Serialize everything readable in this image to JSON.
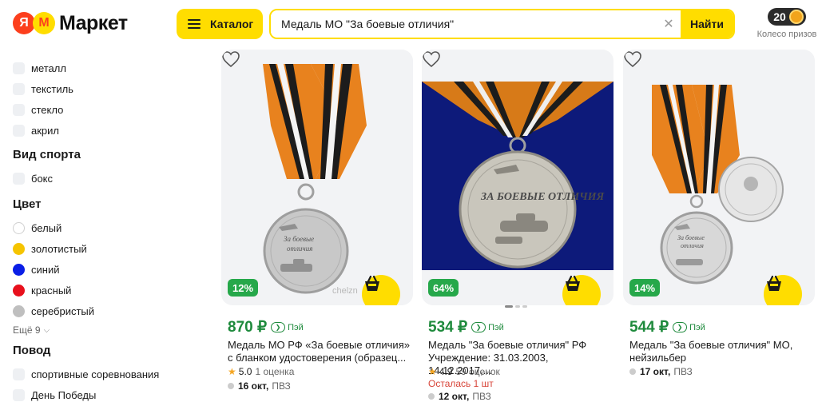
{
  "header": {
    "logo_text": "Маркет",
    "logo_ya": "Я",
    "logo_m": "M",
    "catalog_label": "Каталог",
    "search_value": "Медаль МО \"За боевые отличия\"",
    "search_button": "Найти",
    "prize_count": "20",
    "prize_label": "Колесо призов"
  },
  "sidebar": {
    "material_options": [
      "металл",
      "текстиль",
      "стекло",
      "акрил"
    ],
    "sport_title": "Вид спорта",
    "sport_options": [
      "бокс"
    ],
    "color_title": "Цвет",
    "color_options": [
      {
        "label": "белый",
        "color": "#ffffff"
      },
      {
        "label": "золотистый",
        "color": "#f5c400"
      },
      {
        "label": "синий",
        "color": "#0a1ee6"
      },
      {
        "label": "красный",
        "color": "#e8101c"
      },
      {
        "label": "серебристый",
        "color": "#bfbfbf"
      }
    ],
    "more_label": "Ещё 9",
    "occasion_title": "Повод",
    "occasion_options": [
      "спортивные соревнования",
      "День Победы"
    ]
  },
  "products": [
    {
      "discount": "12%",
      "price": "870 ₽",
      "pay_label": "Пэй",
      "title": "Медаль МО РФ «За боевые отличия» с бланком удостоверения (образец...",
      "rating": "5.0",
      "reviews": "1 оценка",
      "stock_note": "",
      "delivery_date": "16 окт,",
      "delivery_type": "ПВЗ",
      "watermark": "chelzn"
    },
    {
      "discount": "64%",
      "price": "534 ₽",
      "pay_label": "Пэй",
      "title": "Медаль \"За боевые отличия\" РФ Учреждение: 31.03.2003, 14.12.2017,...",
      "rating": "4.9",
      "reviews": "59 оценок",
      "stock_note": "Осталась 1 шт",
      "delivery_date": "12 окт,",
      "delivery_type": "ПВЗ",
      "medal_text": "ЗА БОЕВЫЕ ОТЛИЧИЯ"
    },
    {
      "discount": "14%",
      "price": "544 ₽",
      "pay_label": "Пэй",
      "title": "Медаль \"За боевые отличия\" МО, нейзильбер",
      "rating": "",
      "reviews": "",
      "stock_note": "",
      "delivery_date": "17 окт,",
      "delivery_type": "ПВЗ"
    }
  ]
}
